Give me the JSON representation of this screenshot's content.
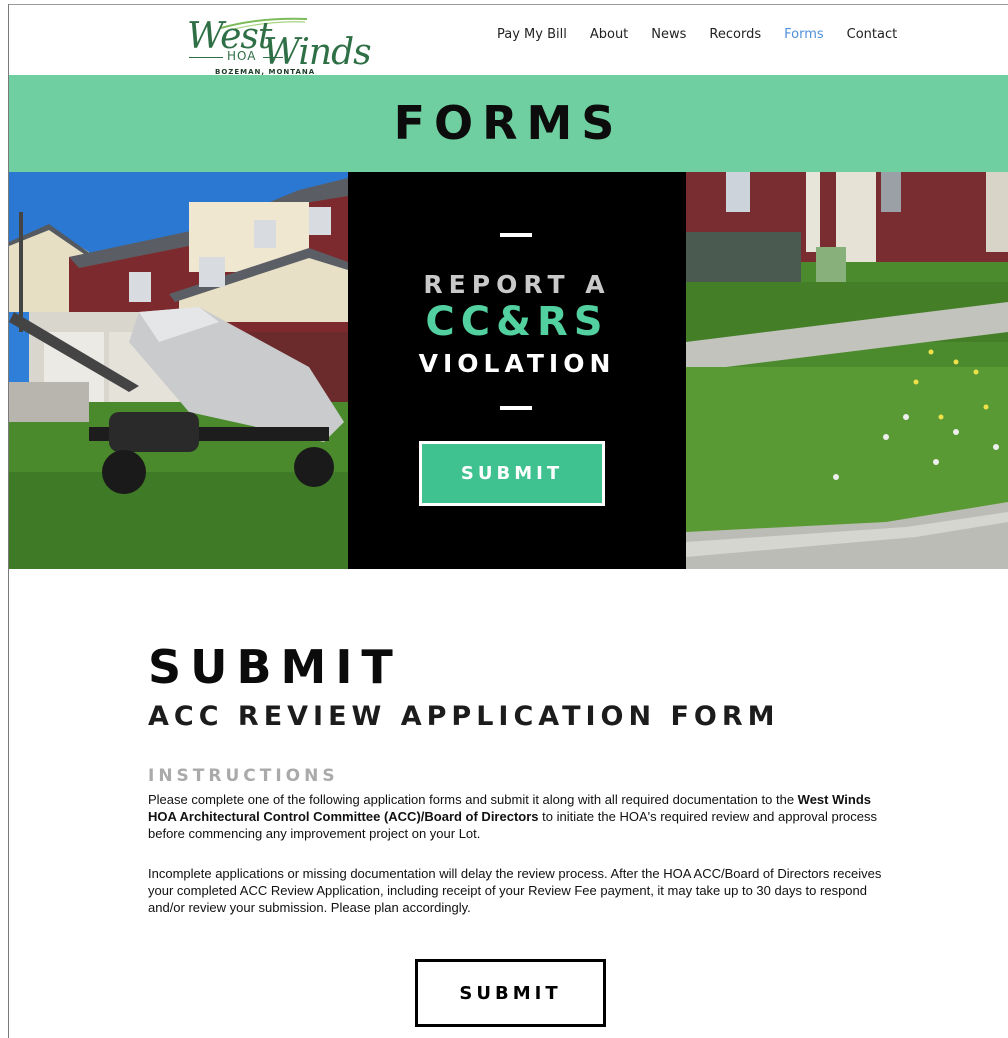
{
  "logo": {
    "word_1": "West",
    "word_2": "Winds",
    "badge": "HOA",
    "location": "BOZEMAN, MONTANA",
    "brand_color": "#2f6f45"
  },
  "nav": {
    "items": [
      {
        "label": "Pay My Bill"
      },
      {
        "label": "About"
      },
      {
        "label": "News"
      },
      {
        "label": "Records"
      },
      {
        "label": "Forms",
        "active": true
      },
      {
        "label": "Contact"
      }
    ],
    "active_color": "#4e8fd8"
  },
  "forms_band": {
    "title": "FORMS",
    "background": "#6fcfa0"
  },
  "hero": {
    "line_1": "REPORT A",
    "line_2": "CC&RS",
    "line_3": "VIOLATION",
    "button_label": "SUBMIT",
    "accent": "#52d09f",
    "button_color": "#3fc290"
  },
  "content": {
    "heading": "SUBMIT",
    "subheading": "ACC REVIEW APPLICATION FORM",
    "instructions_label": "INSTRUCTIONS",
    "para1_before": "Please complete one of the following application forms and submit it along with all required documentation to the ",
    "para1_bold": "West Winds HOA Architectural Control Committee (ACC)/Board of Directors",
    "para1_after": " to initiate the HOA's required review and approval process before commencing any improvement project on your Lot.",
    "para2": "Incomplete applications or missing documentation will delay the review process. After the HOA ACC/Board of Directors receives your completed ACC Review Application, including receipt of your Review Fee payment, it may take up to 30 days to respond and/or review your submission. Please plan accordingly.",
    "button_label": "SUBMIT"
  }
}
